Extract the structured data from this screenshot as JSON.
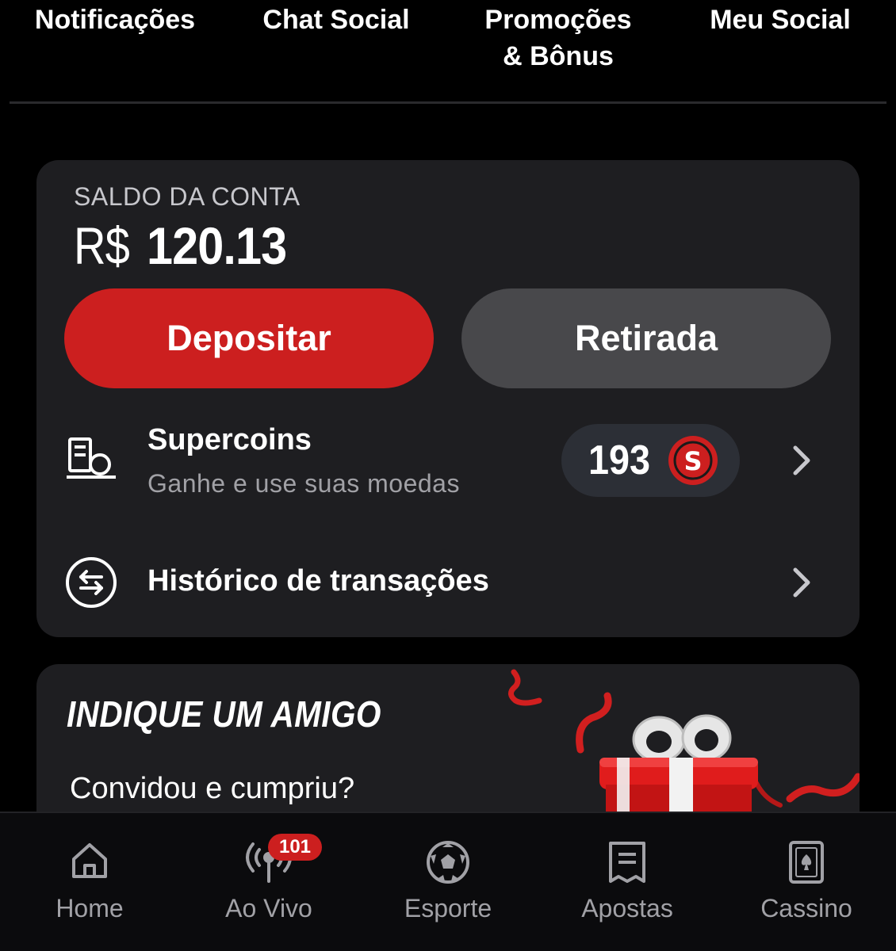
{
  "top_tabs": [
    "Notificações",
    "Chat Social",
    "Promoções\n& Bônus",
    "Meu Social"
  ],
  "balance": {
    "label": "SALDO DA CONTA",
    "currency": "R$",
    "amount": "120.13"
  },
  "actions": {
    "deposit_label": "Depositar",
    "withdraw_label": "Retirada"
  },
  "supercoins": {
    "title": "Supercoins",
    "subtitle": "Ganhe e use suas moedas",
    "count": "193",
    "coin_letter": "S"
  },
  "history": {
    "title": "Histórico de transações"
  },
  "referral": {
    "title": "INDIQUE UM AMIGO",
    "subtitle": "Convidou e cumpriu?"
  },
  "bottom_nav": [
    {
      "label": "Home",
      "icon": "home-icon"
    },
    {
      "label": "Ao Vivo",
      "icon": "broadcast-icon",
      "badge": "101"
    },
    {
      "label": "Esporte",
      "icon": "soccer-ball-icon"
    },
    {
      "label": "Apostas",
      "icon": "receipt-icon"
    },
    {
      "label": "Cassino",
      "icon": "playing-card-icon"
    }
  ],
  "colors": {
    "accent": "#cc1f1f",
    "card_bg": "#1e1e21",
    "secondary_button": "#48484b",
    "muted_text": "#a1a1a6"
  }
}
